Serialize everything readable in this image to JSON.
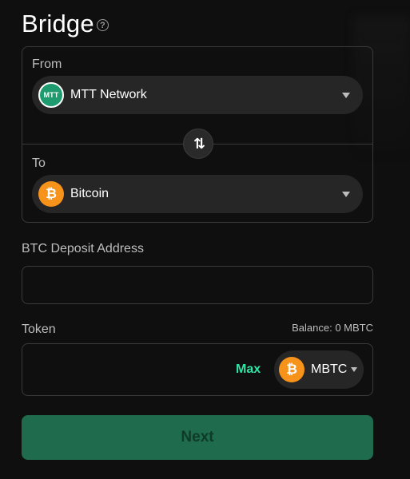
{
  "header": {
    "title": "Bridge",
    "help_icon": "?"
  },
  "from": {
    "label": "From",
    "selected": "MTT Network",
    "icon_text": "MTT"
  },
  "to": {
    "label": "To",
    "selected": "Bitcoin",
    "icon_text": "₿"
  },
  "swap": {
    "icon": "⇅"
  },
  "deposit": {
    "label": "BTC Deposit Address",
    "value": "",
    "placeholder": ""
  },
  "token": {
    "label": "Token",
    "balance": "Balance: 0 MBTC",
    "amount": "",
    "max_label": "Max",
    "selected": "MBTC",
    "icon_text": "₿"
  },
  "actions": {
    "next_label": "Next"
  },
  "colors": {
    "accent": "#2fe3a5",
    "button_bg": "#1f6b4d",
    "btc": "#f7931a",
    "mtt": "#1e9b6f"
  }
}
